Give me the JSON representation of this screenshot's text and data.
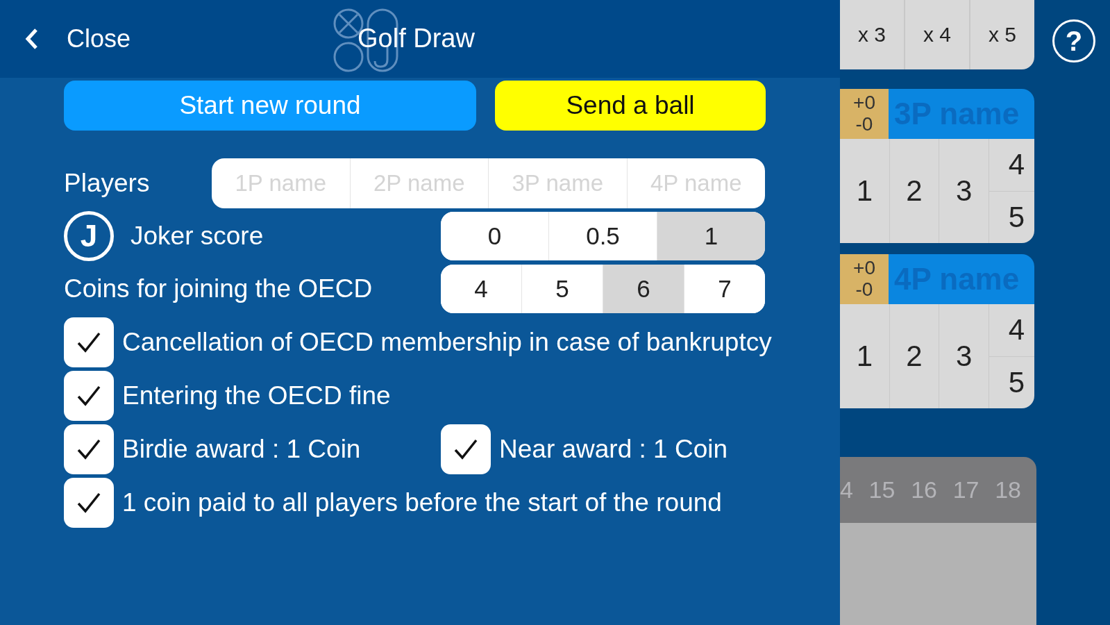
{
  "header": {
    "back_label": "Close",
    "title": "Golf Draw"
  },
  "actions": [
    {
      "label": "Start new round",
      "kind": "primary"
    },
    {
      "label": "Send a ball",
      "kind": "accent"
    }
  ],
  "players": {
    "label": "Players",
    "fields": [
      {
        "placeholder": "1P name"
      },
      {
        "placeholder": "2P name"
      },
      {
        "placeholder": "3P name"
      },
      {
        "placeholder": "4P name"
      }
    ]
  },
  "joker": {
    "icon_letter": "J",
    "label": "Joker score",
    "options": [
      {
        "label": "0",
        "selected": false
      },
      {
        "label": "0.5",
        "selected": false
      },
      {
        "label": "1",
        "selected": true
      }
    ]
  },
  "coins": {
    "label": "Coins for joining the OECD",
    "options": [
      {
        "label": "4",
        "selected": false
      },
      {
        "label": "5",
        "selected": false
      },
      {
        "label": "6",
        "selected": true
      },
      {
        "label": "7",
        "selected": false
      }
    ]
  },
  "checkbox_rows": [
    {
      "items": [
        {
          "label": "Cancellation of OECD membership in case of bankruptcy",
          "checked": true
        }
      ]
    },
    {
      "items": [
        {
          "label": "Entering the OECD fine",
          "checked": true
        }
      ]
    },
    {
      "items": [
        {
          "label": "Birdie award : 1 Coin",
          "checked": true
        },
        {
          "label": "Near award : 1 Coin",
          "checked": true
        }
      ]
    },
    {
      "items": [
        {
          "label": "1 coin paid to all players before the start of the round",
          "checked": true
        }
      ]
    }
  ],
  "multipliers": [
    "x 3",
    "x 4",
    "x 5"
  ],
  "help_label": "?",
  "scorecards": [
    {
      "plus": "+0",
      "minus": "-0",
      "name": "3P name",
      "cells": [
        "1",
        "2",
        "3"
      ],
      "stacked": [
        "4",
        "5"
      ]
    },
    {
      "plus": "+0",
      "minus": "-0",
      "name": "4P name",
      "cells": [
        "1",
        "2",
        "3"
      ],
      "stacked": [
        "4",
        "5"
      ]
    }
  ],
  "holes": [
    "4",
    "15",
    "16",
    "17",
    "18"
  ]
}
